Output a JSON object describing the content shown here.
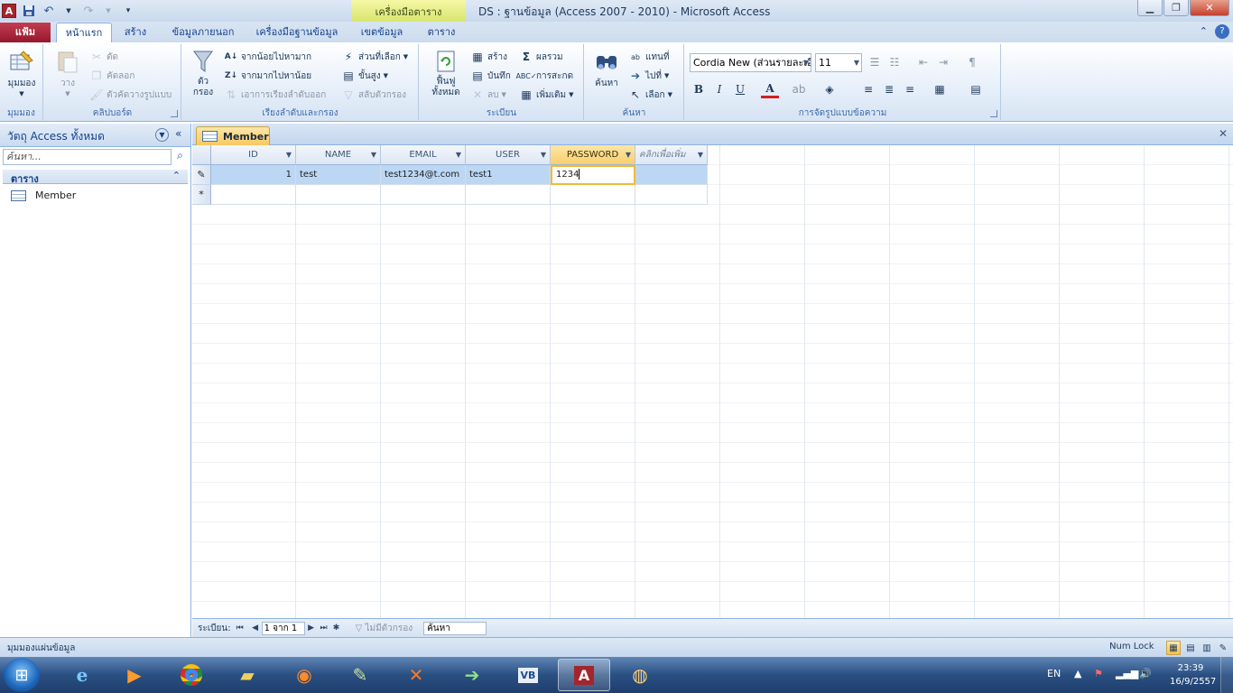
{
  "titlebar": {
    "app_icon": "A",
    "contextual_group": "เครื่องมือตาราง",
    "title": "DS : ฐานข้อมูล (Access 2007 - 2010)  -  Microsoft Access"
  },
  "tabs": {
    "file": "แฟ้ม",
    "home": "หน้าแรก",
    "create": "สร้าง",
    "external": "ข้อมูลภายนอก",
    "dbtools": "เครื่องมือฐานข้อมูล",
    "fields": "เขตข้อมูล",
    "table": "ตาราง"
  },
  "ribbon": {
    "views": {
      "view": "มุมมอง",
      "group": "มุมมอง"
    },
    "clipboard": {
      "paste": "วาง",
      "cut": "ตัด",
      "copy": "คัดลอก",
      "format_painter": "ตัวคัดวางรูปแบบ",
      "group": "คลิปบอร์ด"
    },
    "sortfilter": {
      "filter": "ตัว\nกรอง",
      "ascending": "จากน้อยไปหามาก",
      "descending": "จากมากไปหาน้อย",
      "remove_sort": "เอาการเรียงลำดับออก",
      "selection": "ส่วนที่เลือก",
      "advanced": "ขั้นสูง",
      "toggle_filter": "สลับตัวกรอง",
      "group": "เรียงลำดับและกรอง"
    },
    "records": {
      "refresh": "ฟื้นฟู\nทั้งหมด",
      "new": "สร้าง",
      "save": "บันทึก",
      "delete": "ลบ",
      "totals": "ผลรวม",
      "spelling": "การสะกด",
      "more": "เพิ่มเติม",
      "group": "ระเบียน"
    },
    "find": {
      "find": "ค้นหา",
      "replace": "แทนที่",
      "goto": "ไปที่",
      "select": "เลือก",
      "group": "ค้นหา"
    },
    "textformat": {
      "font": "Cordia New (ส่วนรายละเอี",
      "size": "11",
      "group": "การจัดรูปแบบข้อความ"
    }
  },
  "nav": {
    "title": "วัตถุ Access ทั้งหมด",
    "search_placeholder": "ค้นหา...",
    "group": "ตาราง",
    "items": [
      {
        "label": "Member"
      }
    ]
  },
  "document": {
    "tab": "Member",
    "columns": [
      "ID",
      "NAME",
      "EMAIL",
      "USER",
      "PASSWORD",
      "คลิกเพื่อเพิ่ม"
    ],
    "rows": [
      {
        "ID": "1",
        "NAME": "test",
        "EMAIL": "test1234@t.com",
        "USER": "test1",
        "PASSWORD": "1234"
      }
    ],
    "new_row_marker": "*"
  },
  "record_nav": {
    "label": "ระเบียน:",
    "position": "1 จาก 1",
    "filter": "ไม่มีตัวกรอง",
    "search": "ค้นหา"
  },
  "status": {
    "left": "มุมมองแผ่นข้อมูล",
    "numlock": "Num Lock"
  },
  "taskbar": {
    "lang": "EN",
    "time": "23:39",
    "date": "16/9/2557"
  }
}
